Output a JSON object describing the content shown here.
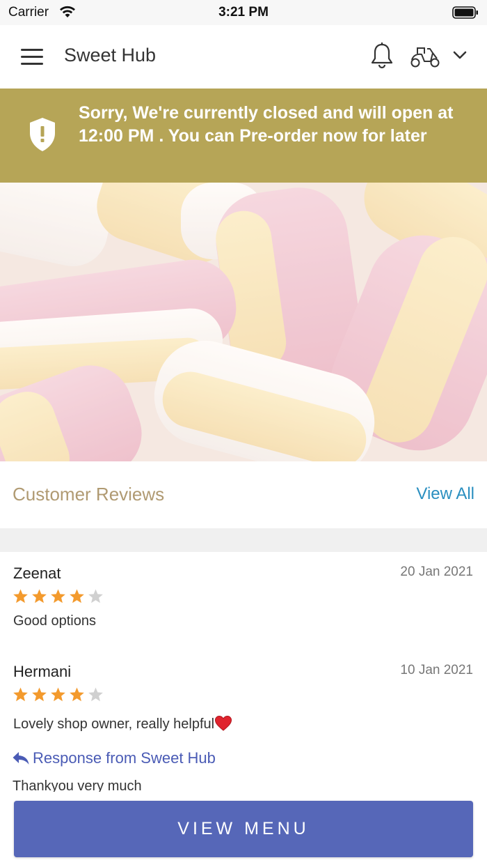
{
  "status_bar": {
    "carrier": "Carrier",
    "time": "3:21 PM"
  },
  "header": {
    "title": "Sweet Hub",
    "icons": [
      "menu-icon",
      "bell-icon",
      "scooter-icon",
      "chevron-down-icon"
    ]
  },
  "banner": {
    "message": "Sorry, We're currently closed and will open at 12:00 PM . You can Pre-order now for later",
    "icon": "shield-alert-icon",
    "color": "#b6a557"
  },
  "hero": {
    "icon": "marshmallow-photo"
  },
  "reviews": {
    "title": "Customer Reviews",
    "view_all_label": "View All",
    "items": [
      {
        "name": "Zeenat",
        "date": "20 Jan 2021",
        "rating": 4,
        "max_rating": 5,
        "text": "Good options"
      },
      {
        "name": "Hermani",
        "date": "10 Jan 2021",
        "rating": 4,
        "max_rating": 5,
        "text": "Lovely shop owner, really helpful",
        "response_label": "Response from Sweet Hub",
        "response_text": "Thankyou very much"
      }
    ]
  },
  "footer": {
    "button_label": "VIEW MENU",
    "button_color": "#5667b8"
  },
  "colors": {
    "star_filled": "#f39a2d",
    "star_empty": "#d0d0d0",
    "link": "#2a8fc0",
    "reviews_title": "#b09a72"
  }
}
